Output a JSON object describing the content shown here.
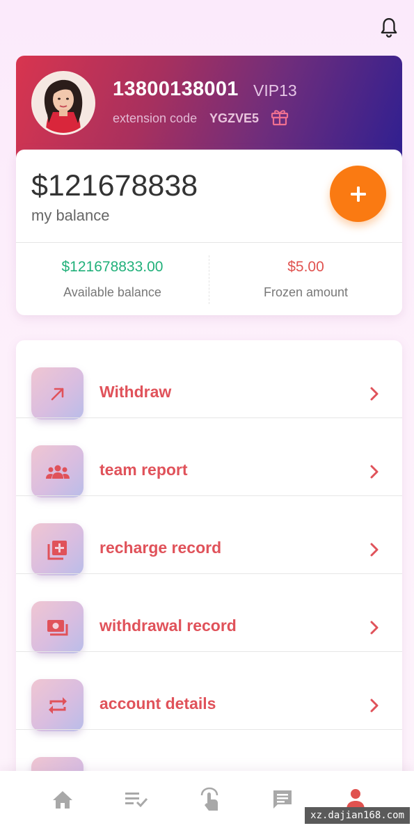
{
  "header": {
    "bell_icon": "bell-icon"
  },
  "profile": {
    "phone": "13800138001",
    "vip": "VIP13",
    "extension_label": "extension code",
    "extension_code": "YGZVE5",
    "gift_icon": "gift-icon",
    "brand_gradient": [
      "#d8354f",
      "#2e1f91"
    ]
  },
  "balance": {
    "amount": "$121678838",
    "label": "my balance",
    "available_value": "$121678833.00",
    "available_label": "Available balance",
    "frozen_value": "$5.00",
    "frozen_label": "Frozen amount",
    "accent_color": "#fa7a12"
  },
  "menu": {
    "items": [
      {
        "label": "Withdraw",
        "icon": "arrow-up-right-icon"
      },
      {
        "label": "team report",
        "icon": "team-icon"
      },
      {
        "label": "recharge record",
        "icon": "add-to-library-icon"
      },
      {
        "label": "withdrawal record",
        "icon": "money-icon"
      },
      {
        "label": "account details",
        "icon": "repeat-icon"
      },
      {
        "label": "",
        "icon": "menu-icon"
      }
    ],
    "label_color": "#e0525a"
  },
  "bottom_nav": {
    "items": [
      {
        "icon": "home-icon"
      },
      {
        "icon": "task-list-icon"
      },
      {
        "icon": "tap-icon"
      },
      {
        "icon": "chat-icon"
      },
      {
        "icon": "person-icon",
        "active": true
      }
    ],
    "active_color": "#e0524f"
  },
  "watermark": "xz.dajian168.com"
}
